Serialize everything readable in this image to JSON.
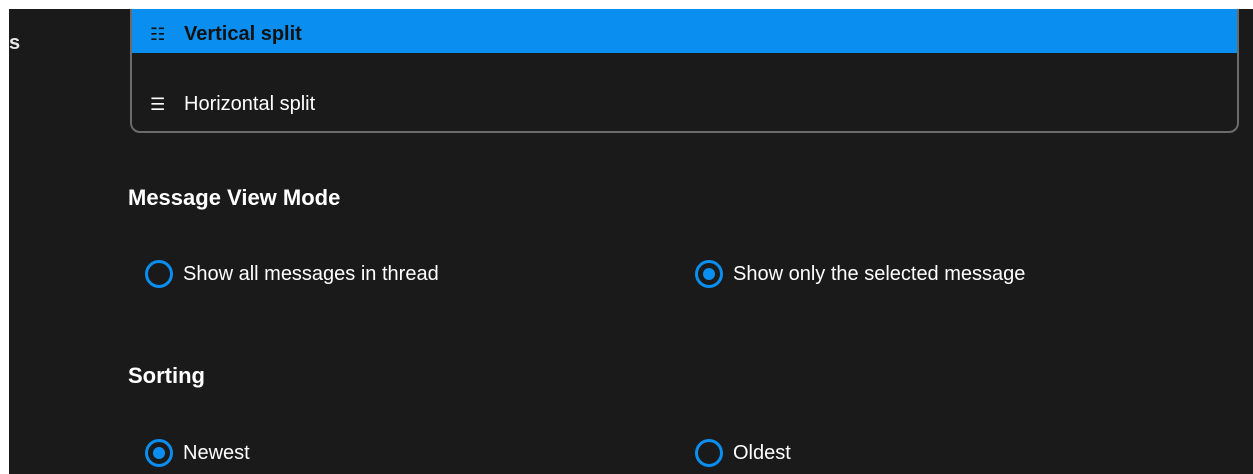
{
  "left_edge_char": "s",
  "layout_dropdown": {
    "options": [
      {
        "label": "Vertical split",
        "icon": "vertical-split-icon",
        "glyph": "☷",
        "selected": true
      },
      {
        "label": "Horizontal split",
        "icon": "horizontal-split-icon",
        "glyph": "☰",
        "selected": false
      }
    ]
  },
  "message_view_mode": {
    "title": "Message View Mode",
    "options": [
      {
        "label": "Show all messages in thread",
        "checked": false
      },
      {
        "label": "Show only the selected message",
        "checked": true
      }
    ]
  },
  "sorting": {
    "title": "Sorting",
    "options": [
      {
        "label": "Newest",
        "checked": true
      },
      {
        "label": "Oldest",
        "checked": false
      }
    ]
  },
  "colors": {
    "accent": "#0a8ef0",
    "background": "#1b1a1a",
    "border": "#6b6b6b"
  }
}
